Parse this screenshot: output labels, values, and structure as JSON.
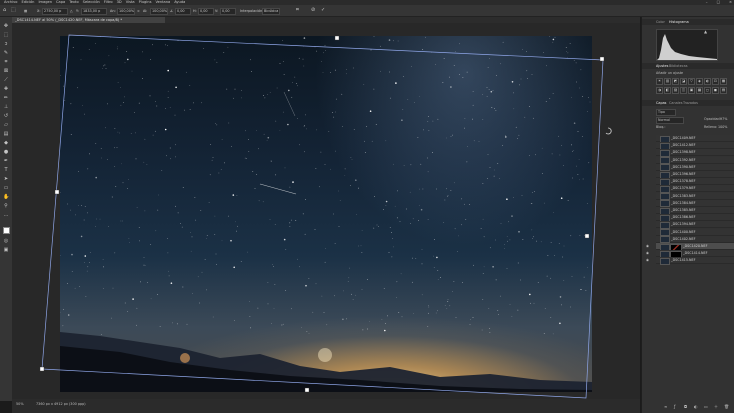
{
  "menu": {
    "items": [
      "Archivo",
      "Edición",
      "Imagen",
      "Capa",
      "Texto",
      "Selección",
      "Filtro",
      "3D",
      "Vista",
      "Plugins",
      "Ventana",
      "Ayuda"
    ],
    "window_controls": [
      "–",
      "□",
      "×"
    ]
  },
  "options_bar": {
    "x_label": "X:",
    "x_value": "2750,00 p",
    "y_label": "Y:",
    "y_value": "1833,00 p",
    "w_label": "An:",
    "w_value": "100,00%",
    "h_label": "Al:",
    "h_value": "100,00%",
    "angle_value": "0,00",
    "hskew_label": "H:",
    "hskew_value": "0,00",
    "vskew_label": "V:",
    "vskew_value": "0,00",
    "interp_label": "Interpolación:",
    "interp_value": "Bicúbica",
    "cancel_icon": "cancel-icon",
    "commit_icon": "check-icon"
  },
  "document_tab": "_DSC1414.NEF al 50% (_DSC1420.NEF, Máscara de capa/8) *",
  "status": {
    "zoom": "50%",
    "doc_info": "7360 px x 4912 px (300 ppp)"
  },
  "panels": {
    "top_tabs": [
      "Color",
      "Histograma"
    ],
    "props_tabs": [
      "Ajustes",
      "Bibliotecas"
    ],
    "add_adjustment": "Añadir un ajuste",
    "layers_tabs": [
      "Capas",
      "Canales",
      "Trazados"
    ],
    "kind_label": "Tipo",
    "blend_mode": "Normal",
    "opacity_label": "Opacidad:",
    "opacity_value": "97%",
    "lock_label": "Bloq.:",
    "fill_label": "Relleno:",
    "fill_value": "100%"
  },
  "layers": [
    {
      "name": "_DSC1409.NEF",
      "visible": false,
      "selected": false,
      "mask": false
    },
    {
      "name": "_DSC1412.NEF",
      "visible": false,
      "selected": false,
      "mask": false
    },
    {
      "name": "_DSC1398.NEF",
      "visible": false,
      "selected": false,
      "mask": false
    },
    {
      "name": "_DSC1392.NEF",
      "visible": false,
      "selected": false,
      "mask": false
    },
    {
      "name": "_DSC1390.NEF",
      "visible": false,
      "selected": false,
      "mask": false
    },
    {
      "name": "_DSC1396.NEF",
      "visible": false,
      "selected": false,
      "mask": false
    },
    {
      "name": "_DSC1378.NEF",
      "visible": false,
      "selected": false,
      "mask": false
    },
    {
      "name": "_DSC1379.NEF",
      "visible": false,
      "selected": false,
      "mask": false
    },
    {
      "name": "_DSC1383.NEF",
      "visible": false,
      "selected": false,
      "mask": false
    },
    {
      "name": "_DSC1384.NEF",
      "visible": false,
      "selected": false,
      "mask": false
    },
    {
      "name": "_DSC1385.NEF",
      "visible": false,
      "selected": false,
      "mask": false
    },
    {
      "name": "_DSC1386.NEF",
      "visible": false,
      "selected": false,
      "mask": false
    },
    {
      "name": "_DSC1394.NEF",
      "visible": false,
      "selected": false,
      "mask": false
    },
    {
      "name": "_DSC1400.NEF",
      "visible": false,
      "selected": false,
      "mask": false
    },
    {
      "name": "_DSC1402.NEF",
      "visible": false,
      "selected": false,
      "mask": false
    },
    {
      "name": "_DSC1420.NEF",
      "visible": true,
      "selected": true,
      "mask": true
    },
    {
      "name": "_DSC1414.NEF",
      "visible": true,
      "selected": false,
      "mask": true
    },
    {
      "name": "_DSC1415.NEF",
      "visible": true,
      "selected": false,
      "mask": false
    }
  ],
  "tool_icons": [
    "move-icon",
    "marquee-icon",
    "lasso-icon",
    "quick-select-icon",
    "crop-icon",
    "frame-icon",
    "eyedropper-icon",
    "healing-icon",
    "brush-icon",
    "stamp-icon",
    "history-brush-icon",
    "eraser-icon",
    "gradient-icon",
    "blur-icon",
    "dodge-icon",
    "pen-icon",
    "type-icon",
    "path-select-icon",
    "rectangle-icon",
    "hand-icon",
    "zoom-icon",
    "more-icon"
  ],
  "colors": {
    "panel_bg": "#323232",
    "canvas_bg": "#282828",
    "selection": "#4d4d4d",
    "transform_line": "#8fa6e8"
  }
}
